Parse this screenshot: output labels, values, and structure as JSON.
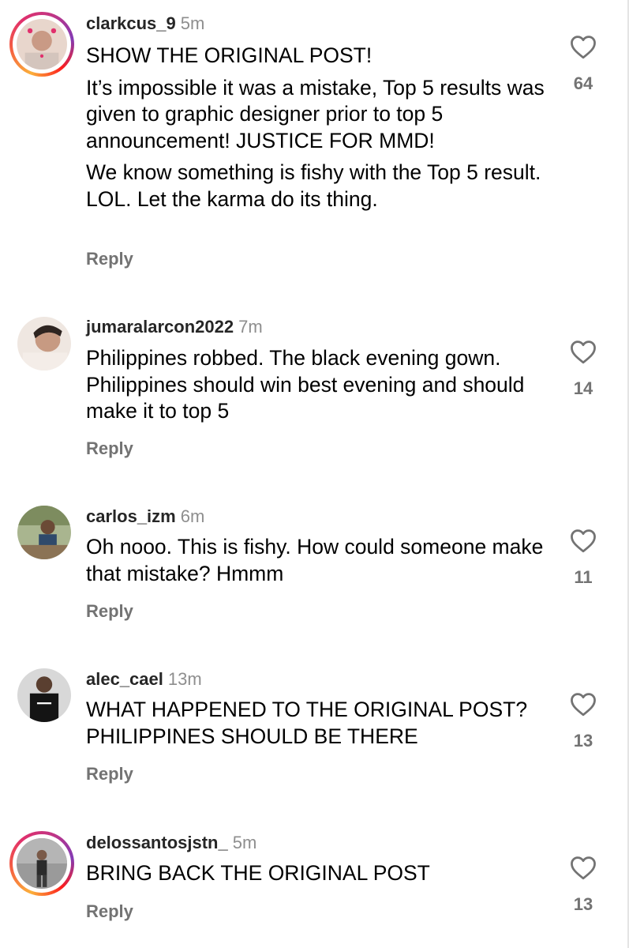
{
  "comments": [
    {
      "username": "clarkcus_9",
      "time": "5m",
      "paragraphs": [
        "SHOW THE ORIGINAL POST!",
        "It’s impossible it was a mistake, Top 5 results was given to graphic designer prior to top 5 announcement! JUSTICE FOR MMD!",
        "We know something is fishy with the Top 5 result. LOL. Let the karma do its thing."
      ],
      "reply_label": "Reply",
      "likes": "64",
      "story_ring": true,
      "avatar_colors": [
        "#d9b3a3",
        "#4a3b36"
      ]
    },
    {
      "username": "jumaralarcon2022",
      "time": "7m",
      "paragraphs": [
        "Philippines robbed. The black evening gown. Philippines should win best evening and should make it to top 5"
      ],
      "reply_label": "Reply",
      "likes": "14",
      "story_ring": false,
      "avatar_colors": [
        "#c9a58c",
        "#2e2420"
      ]
    },
    {
      "username": "carlos_izm",
      "time": "6m",
      "paragraphs": [
        "Oh nooo. This is fishy. How could someone make that mistake? Hmmm"
      ],
      "reply_label": "Reply",
      "likes": "11",
      "story_ring": false,
      "avatar_colors": [
        "#8a9a6e",
        "#2f4a6b"
      ]
    },
    {
      "username": "alec_cael",
      "time": "13m",
      "paragraphs": [
        "WHAT HAPPENED TO THE ORIGINAL POST? PHILIPPINES SHOULD BE THERE"
      ],
      "reply_label": "Reply",
      "likes": "13",
      "story_ring": false,
      "avatar_colors": [
        "#3a3a3a",
        "#111111"
      ]
    },
    {
      "username": "delossantosjstn_",
      "time": "5m",
      "paragraphs": [
        "BRING BACK THE ORIGINAL POST"
      ],
      "reply_label": "Reply",
      "likes": "13",
      "story_ring": true,
      "avatar_colors": [
        "#7d7d7d",
        "#2b2b2b"
      ]
    }
  ],
  "icons": {
    "like": "heart-outline-icon"
  },
  "colors": {
    "username": "#262626",
    "meta": "#8e8e8e",
    "reply": "#737373"
  }
}
